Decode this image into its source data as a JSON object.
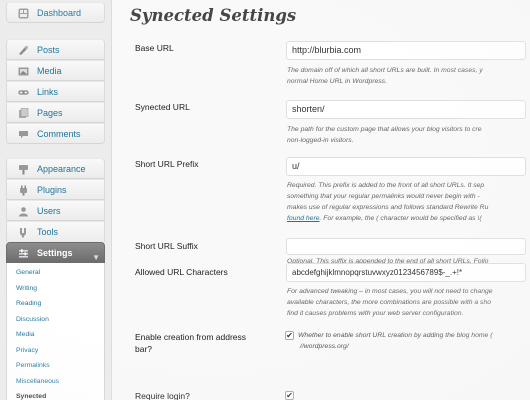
{
  "sidebar": {
    "items_top": [
      {
        "label": "Dashboard",
        "icon": "dashboard-icon"
      }
    ],
    "items_content": [
      {
        "label": "Posts",
        "icon": "posts-icon"
      },
      {
        "label": "Media",
        "icon": "media-icon"
      },
      {
        "label": "Links",
        "icon": "links-icon"
      },
      {
        "label": "Pages",
        "icon": "pages-icon"
      },
      {
        "label": "Comments",
        "icon": "comments-icon"
      }
    ],
    "items_admin": [
      {
        "label": "Appearance",
        "icon": "appearance-icon"
      },
      {
        "label": "Plugins",
        "icon": "plugins-icon"
      },
      {
        "label": "Users",
        "icon": "users-icon"
      },
      {
        "label": "Tools",
        "icon": "tools-icon"
      }
    ],
    "current": {
      "label": "Settings",
      "icon": "settings-icon"
    },
    "submenu": [
      "General",
      "Writing",
      "Reading",
      "Discussion",
      "Media",
      "Privacy",
      "Permalinks",
      "Miscellaneous",
      "Synected"
    ]
  },
  "page": {
    "title": "Synected Settings"
  },
  "fields": {
    "base_url": {
      "label": "Base URL",
      "value": "http://blurbia.com",
      "desc1": "The domain off of which all short URLs are built. In most cases, y",
      "desc2": "normal Home URL in Wordpress."
    },
    "synected_url": {
      "label": "Synected URL",
      "value": "shorten/",
      "desc1": "The path for the custom page that allows your blog visitors to cre",
      "desc2": "non-logged-in visitors."
    },
    "prefix": {
      "label": "Short URL Prefix",
      "value": "u/",
      "desc1": "Required. This prefix is added to the front of all short URLs. It sep",
      "desc2": "something that your regular permalinks would never begin with -",
      "desc3": "makes use of regular expressions and follows standard Rewrite Ru",
      "desc4_link": "found here",
      "desc4_rest": ". For example, the ( character would be specified as \\("
    },
    "suffix": {
      "label": "Short URL Suffix",
      "value": "",
      "desc1": "Optional. This suffix is appended to the end of all short URLs. Follo"
    },
    "allowed_chars": {
      "label": "Allowed URL Characters",
      "value": "abcdefghijklmnopqrstuvwxyz0123456789$-_.+!*",
      "desc1": "For advanced tweaking – in most cases, you will not need to change",
      "desc2": "available characters, the more combinations are possible with a sho",
      "desc3": "find it causes problems with your web server configuration."
    },
    "enable_creation": {
      "label_line1": "Enable creation from address",
      "label_line2": "bar?",
      "checked_glyph": "✔",
      "desc1": "Whether to enable short URL creation by adding the blog home (",
      "desc2": "//wordpress.org/"
    },
    "require_login": {
      "label": "Require login?",
      "checked_glyph": "✔"
    }
  },
  "colors": {
    "link": "#21759b",
    "current_menu": "#7a7a7a"
  }
}
